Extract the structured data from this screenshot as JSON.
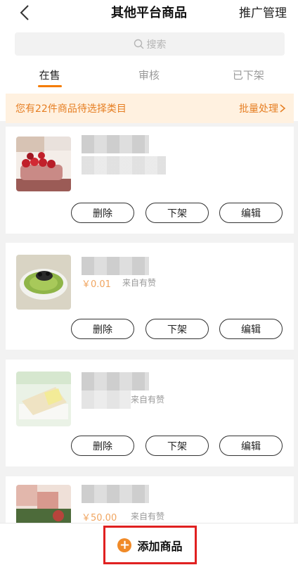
{
  "header": {
    "title": "其他平台商品",
    "right_action": "推广管理"
  },
  "search": {
    "placeholder": "搜索"
  },
  "tabs": [
    {
      "label": "在售",
      "active": true
    },
    {
      "label": "审核",
      "active": false
    },
    {
      "label": "已下架",
      "active": false
    }
  ],
  "notice": {
    "text": "您有22件商品待选择类目",
    "action": "批量处理"
  },
  "products": [
    {
      "price": "",
      "source": "",
      "actions": [
        "删除",
        "下架",
        "编辑"
      ]
    },
    {
      "price": "￥0.01",
      "source": "来自有赞",
      "actions": [
        "删除",
        "下架",
        "编辑"
      ]
    },
    {
      "price": "",
      "source": "来自有赞",
      "actions": [
        "删除",
        "下架",
        "编辑"
      ]
    },
    {
      "price": "￥50.00",
      "source": "来自有赞",
      "actions": []
    }
  ],
  "bottom": {
    "add_label": "添加商品",
    "add_icon": "plus-circle-icon"
  },
  "colors": {
    "accent": "#f57c00",
    "notice_bg": "#fff1e0",
    "notice_text": "#e67e22",
    "highlight_border": "#e02020"
  }
}
